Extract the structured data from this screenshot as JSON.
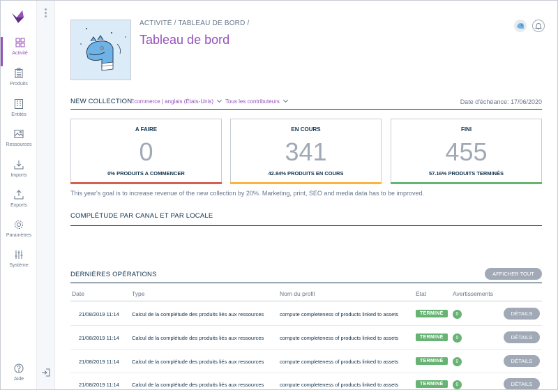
{
  "nav": {
    "items": [
      {
        "label": "Activité",
        "icon": "dashboard-icon"
      },
      {
        "label": "Produits",
        "icon": "clipboard-icon"
      },
      {
        "label": "Entités",
        "icon": "entity-icon"
      },
      {
        "label": "Ressources",
        "icon": "image-icon"
      },
      {
        "label": "Imports",
        "icon": "import-icon"
      },
      {
        "label": "Exports",
        "icon": "export-icon"
      },
      {
        "label": "Paramètres",
        "icon": "gear-icon"
      },
      {
        "label": "Système",
        "icon": "sliders-icon"
      }
    ],
    "help": "Aide"
  },
  "header": {
    "breadcrumb": "ACTIVITÉ / TABLEAU DE BORD /",
    "title": "Tableau de bord"
  },
  "collection": {
    "heading": "NEW COLLECTION",
    "filter_channel": "Ecommerce | anglais (États-Unis)",
    "filter_contributors": "Tous les contributeurs",
    "due_date": "Date d'échéance: 17/06/2020"
  },
  "kpis": [
    {
      "title": "A FAIRE",
      "value": "0",
      "subtitle": "0% PRODUITS A COMMENCER",
      "color": "#d4604f"
    },
    {
      "title": "EN COURS",
      "value": "341",
      "subtitle": "42.84% PRODUITS EN COURS",
      "color": "#f9b53f"
    },
    {
      "title": "FINI",
      "value": "455",
      "subtitle": "57.16% PRODUITS TERMINÉS",
      "color": "#67b373"
    }
  ],
  "goal_text": "This year's goal is to increase revenue of the new collection by 20%. Marketing, print, SEO and media data has to be improved.",
  "completeness_heading": "COMPLÉTUDE PAR CANAL ET PAR LOCALE",
  "operations": {
    "heading": "DERNIÈRES OPÉRATIONS",
    "show_all": "AFFICHER TOUT",
    "columns": [
      "Date",
      "Type",
      "Nom du profil",
      "État",
      "Avertissements"
    ],
    "rows": [
      {
        "date": "21/08/2019 11:14",
        "type": "Calcul de la complétude des produits liés aux ressources",
        "profile": "compute completeness of products linked to assets",
        "state": "TERMINÉ",
        "warnings": "0",
        "action": "DÉTAILS"
      },
      {
        "date": "21/08/2019 11:14",
        "type": "Calcul de la complétude des produits liés aux ressources",
        "profile": "compute completeness of products linked to assets",
        "state": "TERMINÉ",
        "warnings": "0",
        "action": "DÉTAILS"
      },
      {
        "date": "21/08/2019 11:14",
        "type": "Calcul de la complétude des produits liés aux ressources",
        "profile": "compute completeness of products linked to assets",
        "state": "TERMINÉ",
        "warnings": "0",
        "action": "DÉTAILS"
      },
      {
        "date": "21/08/2019 11:14",
        "type": "Calcul de la complétude des produits liés aux ressources",
        "profile": "compute completeness of products linked to assets",
        "state": "TERMINÉ",
        "warnings": "0",
        "action": "DÉTAILS"
      }
    ]
  },
  "colors": {
    "accent": "#9452ba",
    "text": "#11324d",
    "muted": "#67768a",
    "success": "#67b373"
  }
}
